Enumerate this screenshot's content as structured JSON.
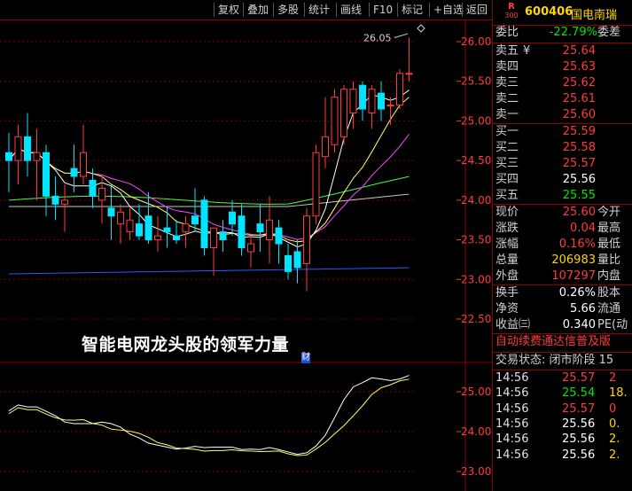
{
  "toolbar": {
    "buttons": [
      "复权",
      "叠加",
      "多股",
      "统计",
      "画线",
      "F10",
      "标记",
      "+自选",
      "返回"
    ]
  },
  "chart": {
    "price_labels": [
      "26.00",
      "25.50",
      "25.00",
      "24.50",
      "24.00",
      "23.50",
      "23.00",
      "22.50"
    ],
    "peak_label": "26.05",
    "caption": "智能电网龙头股的领军力量",
    "cursor_mark": "财",
    "sub_labels": [
      "25.00",
      "24.00",
      "23.00"
    ],
    "colors": {
      "up": "#ff3b3b",
      "down": "#00e5ff",
      "ma5": "#ffffff",
      "ma10": "#ffff66",
      "ma20": "#ff44ff",
      "ma30": "#44ff44",
      "ma60": "#c8c8c8",
      "ma120": "#3355ff"
    }
  },
  "chart_data": {
    "type": "candlestick",
    "ylim": [
      22.4,
      26.2
    ],
    "candles": [
      {
        "o": 24.6,
        "h": 24.85,
        "l": 24.1,
        "c": 24.5
      },
      {
        "o": 24.5,
        "h": 24.95,
        "l": 24.2,
        "c": 24.8
      },
      {
        "o": 24.8,
        "h": 25.1,
        "l": 24.3,
        "c": 24.5
      },
      {
        "o": 24.5,
        "h": 24.9,
        "l": 24.0,
        "c": 24.6
      },
      {
        "o": 24.6,
        "h": 24.7,
        "l": 23.8,
        "c": 24.05
      },
      {
        "o": 24.05,
        "h": 24.3,
        "l": 23.75,
        "c": 23.95
      },
      {
        "o": 23.95,
        "h": 24.2,
        "l": 23.6,
        "c": 24.0
      },
      {
        "o": 24.4,
        "h": 24.7,
        "l": 24.1,
        "c": 24.3
      },
      {
        "o": 24.3,
        "h": 24.95,
        "l": 24.2,
        "c": 24.6
      },
      {
        "o": 24.25,
        "h": 24.4,
        "l": 23.9,
        "c": 24.05
      },
      {
        "o": 24.0,
        "h": 24.3,
        "l": 23.7,
        "c": 24.15
      },
      {
        "o": 23.9,
        "h": 24.2,
        "l": 23.5,
        "c": 23.8
      },
      {
        "o": 23.7,
        "h": 23.95,
        "l": 23.45,
        "c": 23.85
      },
      {
        "o": 23.6,
        "h": 23.9,
        "l": 23.5,
        "c": 23.75
      },
      {
        "o": 23.7,
        "h": 23.95,
        "l": 23.5,
        "c": 23.55
      },
      {
        "o": 23.8,
        "h": 24.1,
        "l": 23.45,
        "c": 23.5
      },
      {
        "o": 23.5,
        "h": 23.8,
        "l": 23.35,
        "c": 23.55
      },
      {
        "o": 23.65,
        "h": 23.9,
        "l": 23.4,
        "c": 23.6
      },
      {
        "o": 23.55,
        "h": 23.75,
        "l": 23.45,
        "c": 23.5
      },
      {
        "o": 23.6,
        "h": 23.8,
        "l": 23.4,
        "c": 23.7
      },
      {
        "o": 23.8,
        "h": 24.15,
        "l": 23.6,
        "c": 23.7
      },
      {
        "o": 24.0,
        "h": 24.05,
        "l": 23.3,
        "c": 23.4
      },
      {
        "o": 23.4,
        "h": 23.6,
        "l": 23.05,
        "c": 23.65
      },
      {
        "o": 23.6,
        "h": 23.75,
        "l": 23.35,
        "c": 23.5
      },
      {
        "o": 23.85,
        "h": 24.0,
        "l": 23.55,
        "c": 23.7
      },
      {
        "o": 23.8,
        "h": 23.95,
        "l": 23.3,
        "c": 23.4
      },
      {
        "o": 23.35,
        "h": 23.55,
        "l": 23.15,
        "c": 23.45
      },
      {
        "o": 23.7,
        "h": 23.95,
        "l": 23.35,
        "c": 23.6
      },
      {
        "o": 23.5,
        "h": 24.05,
        "l": 23.2,
        "c": 23.75
      },
      {
        "o": 23.65,
        "h": 23.75,
        "l": 23.2,
        "c": 23.45
      },
      {
        "o": 23.3,
        "h": 23.45,
        "l": 23.0,
        "c": 23.1
      },
      {
        "o": 23.35,
        "h": 23.5,
        "l": 22.95,
        "c": 23.15
      },
      {
        "o": 23.2,
        "h": 23.9,
        "l": 22.85,
        "c": 23.8
      },
      {
        "o": 23.8,
        "h": 24.7,
        "l": 23.7,
        "c": 24.6
      },
      {
        "o": 24.55,
        "h": 25.3,
        "l": 24.4,
        "c": 24.8
      },
      {
        "o": 24.7,
        "h": 25.4,
        "l": 24.6,
        "c": 25.3
      },
      {
        "o": 24.8,
        "h": 25.45,
        "l": 24.7,
        "c": 25.4
      },
      {
        "o": 25.1,
        "h": 25.5,
        "l": 24.9,
        "c": 25.4
      },
      {
        "o": 25.45,
        "h": 25.5,
        "l": 25.0,
        "c": 25.15
      },
      {
        "o": 25.1,
        "h": 25.45,
        "l": 24.9,
        "c": 25.4
      },
      {
        "o": 25.35,
        "h": 25.5,
        "l": 25.0,
        "c": 25.15
      },
      {
        "o": 25.2,
        "h": 25.3,
        "l": 24.95,
        "c": 25.2
      },
      {
        "o": 25.2,
        "h": 25.65,
        "l": 25.15,
        "c": 25.6
      },
      {
        "o": 25.6,
        "h": 26.05,
        "l": 25.5,
        "c": 25.6
      }
    ]
  },
  "panel": {
    "badge_top": "R",
    "badge_bottom": "300",
    "code": "600406",
    "name": "国电南瑞",
    "weibi": {
      "label": "委比",
      "value": "-22.79%",
      "label2": "委差"
    },
    "asks": [
      {
        "label": "卖五",
        "mark": "¥",
        "price": "25.64"
      },
      {
        "label": "卖四",
        "mark": "",
        "price": "25.63"
      },
      {
        "label": "卖三",
        "mark": "",
        "price": "25.62"
      },
      {
        "label": "卖二",
        "mark": "",
        "price": "25.61"
      },
      {
        "label": "卖一",
        "mark": "",
        "price": "25.60"
      }
    ],
    "bids": [
      {
        "label": "买一",
        "price": "25.59",
        "color": "red"
      },
      {
        "label": "买二",
        "price": "25.58",
        "color": "red"
      },
      {
        "label": "买三",
        "price": "25.57",
        "color": "red"
      },
      {
        "label": "买四",
        "price": "25.56",
        "color": "white"
      },
      {
        "label": "买五",
        "price": "25.55",
        "color": "green"
      }
    ],
    "quote": [
      {
        "label": "现价",
        "value": "25.60",
        "color": "red",
        "label2": "今开"
      },
      {
        "label": "涨跌",
        "value": "0.04",
        "color": "red",
        "label2": "最高"
      },
      {
        "label": "涨幅",
        "value": "0.16%",
        "color": "red",
        "label2": "最低"
      },
      {
        "label": "总量",
        "value": "206983",
        "color": "yellow",
        "label2": "量比"
      },
      {
        "label": "外盘",
        "value": "107297",
        "color": "red",
        "label2": "内盘"
      }
    ],
    "stats": [
      {
        "label": "换手",
        "value": "0.26%",
        "label2": "股本"
      },
      {
        "label": "净资",
        "value": "5.66",
        "label2": "流通"
      },
      {
        "label": "收益㈢",
        "value": "0.340",
        "label2": "PE(动"
      }
    ],
    "banner": "自动续费通达信普及版",
    "status": "交易状态: 闭市阶段 15",
    "ticks": [
      {
        "time": "14:56",
        "price": "25.57",
        "pcolor": "red",
        "vol": "2",
        "vcolor": "red"
      },
      {
        "time": "14:56",
        "price": "25.54",
        "pcolor": "green",
        "vol": "18.",
        "vcolor": "yellow"
      },
      {
        "time": "14:56",
        "price": "25.57",
        "pcolor": "red",
        "vol": "0",
        "vcolor": "red"
      },
      {
        "time": "14:56",
        "price": "25.56",
        "pcolor": "white",
        "vol": "0.",
        "vcolor": "yellow"
      },
      {
        "time": "14:56",
        "price": "25.56",
        "pcolor": "white",
        "vol": "2.",
        "vcolor": "yellow"
      },
      {
        "time": "14:56",
        "price": "25.56",
        "pcolor": "white",
        "vol": "2.",
        "vcolor": "yellow"
      }
    ]
  }
}
